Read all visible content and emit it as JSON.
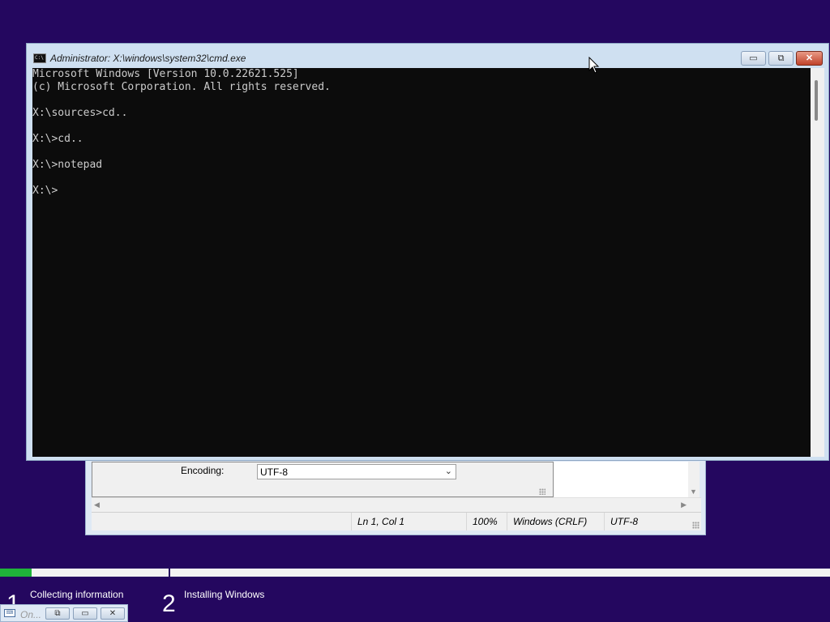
{
  "notepad": {
    "encoding_label": "Encoding:",
    "encoding_value": "UTF-8",
    "status": {
      "position": "Ln 1, Col 1",
      "zoom": "100%",
      "line_ending": "Windows (CRLF)",
      "encoding": "UTF-8"
    }
  },
  "cmd": {
    "title": "Administrator: X:\\windows\\system32\\cmd.exe",
    "icon_text": "C:\\",
    "lines": [
      "Microsoft Windows [Version 10.0.22621.525]",
      "(c) Microsoft Corporation. All rights reserved.",
      "",
      "X:\\sources>cd..",
      "",
      "X:\\>cd..",
      "",
      "X:\\>notepad",
      "",
      "X:\\>"
    ],
    "buttons": {
      "minimize": "▭",
      "maximize": "⧉",
      "close": "✕"
    }
  },
  "setup": {
    "progress": 0.038,
    "steps": [
      {
        "number": "1",
        "label": "Collecting information"
      },
      {
        "number": "2",
        "label": "Installing Windows"
      }
    ]
  },
  "minimized_window": {
    "title": "On...",
    "buttons": {
      "restore": "⧉",
      "maximize": "▭",
      "close": "✕"
    }
  },
  "colors": {
    "background": "#24075f",
    "console_bg": "#0c0c0c",
    "console_text": "#cccccc",
    "progress_fill": "#1fb33a"
  }
}
